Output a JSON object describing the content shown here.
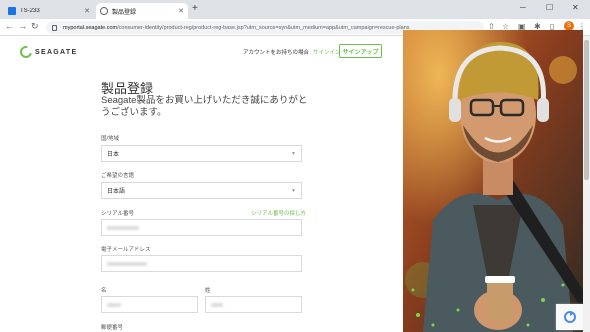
{
  "browser": {
    "tabs": [
      {
        "title": "TS-233"
      },
      {
        "title": "製品登録"
      }
    ],
    "url_host": "myportal.seagate.com",
    "url_path": "/consumer-identity/product-reg/product-reg-base.jsp?utm_source=syn&utm_medium=app&utm_campaign=rescue-plans",
    "profile_initial": "S",
    "new_tab": "+",
    "window_controls": [
      "─",
      "☐",
      "✕"
    ]
  },
  "header": {
    "brand": "SEAGATE",
    "account_prompt": "アカウントをお持ちの場合",
    "signin": "サインイン",
    "signup": "サインアップ"
  },
  "main": {
    "title": "製品登録",
    "subtitle": "Seagate製品をお買い上げいただき誠にありがとうございます。",
    "country_label": "国/地域",
    "country_value": "日本",
    "language_label": "ご希望の言語",
    "language_value": "日本語",
    "serial_label": "シリアル番号",
    "serial_help": "シリアル番号の探し方",
    "email_label": "電子メールアドレス",
    "firstname_label": "名",
    "lastname_label": "姓",
    "postal_label": "郵便番号"
  },
  "colors": {
    "accent": "#6cc04a"
  }
}
